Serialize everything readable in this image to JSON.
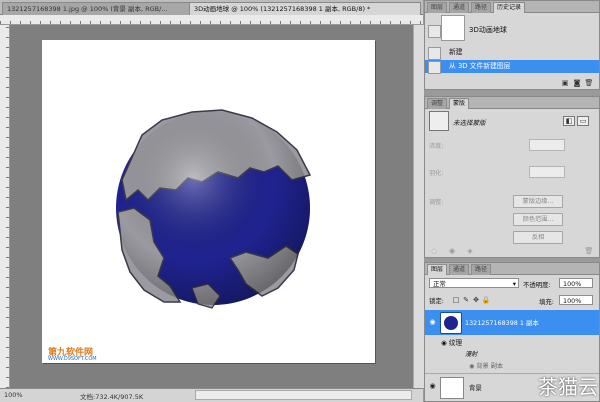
{
  "document_tabs": [
    {
      "label": "1321257168398 1.jpg @ 100% (背景 副本, RGB/...",
      "close": "×"
    },
    {
      "label": "3D动画地球 @ 100% (1321257168398 1 副本, RGB/8) *",
      "close": "×"
    }
  ],
  "status_bar": {
    "zoom": "100%",
    "doc_label": "文档:732.4K/907.5K"
  },
  "canvas_logo": {
    "brand": "第九软件网",
    "url": "WWW.D9SOFT.COM"
  },
  "history_panel": {
    "tabs": [
      "图层",
      "通道",
      "路径",
      "历史记录"
    ],
    "snapshot_label": "3D动画地球",
    "items": [
      {
        "label": "新建",
        "selected": false
      },
      {
        "label": "从 3D 文件新建图层",
        "selected": true
      }
    ]
  },
  "masks_panel": {
    "tabs": [
      "调整",
      "蒙版"
    ],
    "title": "未选择蒙版",
    "density_label": "浓度:",
    "feather_label": "羽化:",
    "refine_label": "调整:",
    "mask_edge_button": "蒙版边缘...",
    "color_range_button": "颜色范围...",
    "invert_button": "反相"
  },
  "layers_panel": {
    "tabs": [
      "图层",
      "通道",
      "路径"
    ],
    "blend_mode": "正常",
    "opacity_label": "不透明度:",
    "opacity_value": "100%",
    "lock_label": "锁定:",
    "fill_label": "填充:",
    "fill_value": "100%",
    "layers": [
      {
        "name": "1321257168398 1 副本",
        "selected": true
      },
      {
        "name": "纹理",
        "selected": false
      },
      {
        "name": "漫射",
        "selected": false
      },
      {
        "name": "背景 副本",
        "selected": false
      },
      {
        "name": "背景",
        "selected": false
      }
    ]
  },
  "watermark": "茶猫云",
  "colors": {
    "selection": "#3b8ff0",
    "ocean": "#1f2390",
    "land": "#9a9aa0"
  },
  "icons": [
    "close-icon",
    "eye-icon",
    "lock-icon",
    "trash-icon",
    "new-layer-icon",
    "camera-icon",
    "chevron-down-icon"
  ]
}
